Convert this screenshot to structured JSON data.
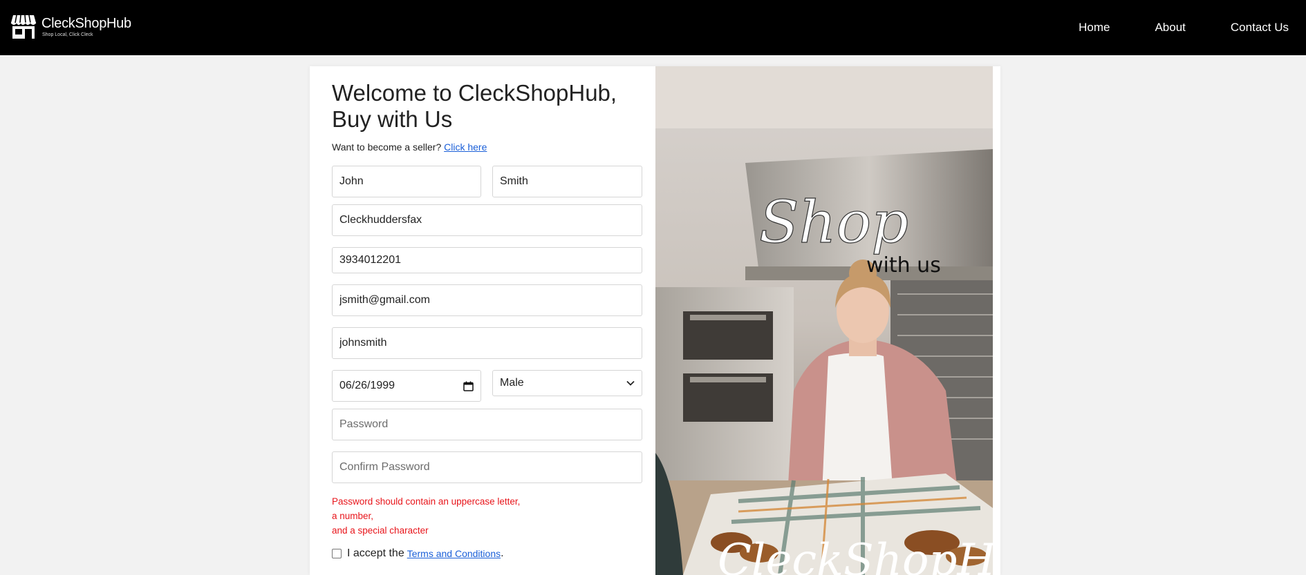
{
  "header": {
    "brand_name": "CleckShopHub",
    "brand_tagline": "Shop Local, Click Cleck",
    "nav": [
      {
        "label": "Home"
      },
      {
        "label": "About"
      },
      {
        "label": "Contact Us"
      }
    ]
  },
  "form": {
    "title": "Welcome to CleckShopHub, Buy with Us",
    "seller_prompt": "Want to become a seller?",
    "seller_link": "Click here",
    "first_name": "John",
    "last_name": "Smith",
    "address": "Cleckhuddersfax",
    "phone": "3934012201",
    "email": "jsmith@gmail.com",
    "username": "johnsmith",
    "dob": "06/26/1999",
    "gender": "Male",
    "password_placeholder": "Password",
    "confirm_password_placeholder": "Confirm Password",
    "error_lines": [
      "Password should contain an uppercase letter,",
      "a number,",
      "and a special character"
    ],
    "terms_prefix": "I accept the",
    "terms_link": "Terms and Conditions",
    "terms_suffix": "."
  },
  "hero": {
    "script_big": "Shop",
    "script_small": "with us",
    "script_bottom": "CleckShopHub"
  },
  "colors": {
    "header_bg": "#000000",
    "page_bg": "#f2f2f2",
    "link": "#1a5fd8",
    "error": "#e8151b"
  }
}
